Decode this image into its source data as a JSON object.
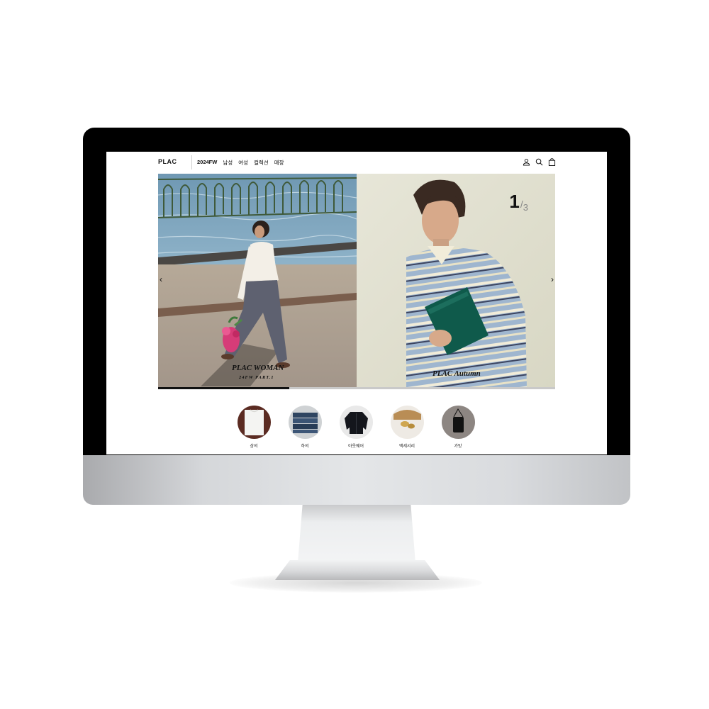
{
  "header": {
    "logo": "PLAC",
    "nav": [
      {
        "label": "2024FW",
        "bold": true
      },
      {
        "label": "남성"
      },
      {
        "label": "여성"
      },
      {
        "label": "컬렉션"
      },
      {
        "label": "매장"
      }
    ],
    "icons": [
      "user-icon",
      "search-icon",
      "shopping-bag-icon"
    ]
  },
  "hero": {
    "left_title": "PLAC WOMAN",
    "left_subtitle": "24FW PART.1",
    "right_title": "PLAC Autumn",
    "counter_current": "1",
    "counter_separator": "/",
    "counter_total": "3",
    "prev_arrow": "‹",
    "next_arrow": "›",
    "progress": 0.33
  },
  "categories": [
    {
      "label": "상의",
      "icon": "top-shirt-icon"
    },
    {
      "label": "하의",
      "icon": "denim-bottoms-icon"
    },
    {
      "label": "아웃웨어",
      "icon": "jacket-icon"
    },
    {
      "label": "액세서리",
      "icon": "accessory-icon"
    },
    {
      "label": "가방",
      "icon": "bag-icon"
    }
  ]
}
